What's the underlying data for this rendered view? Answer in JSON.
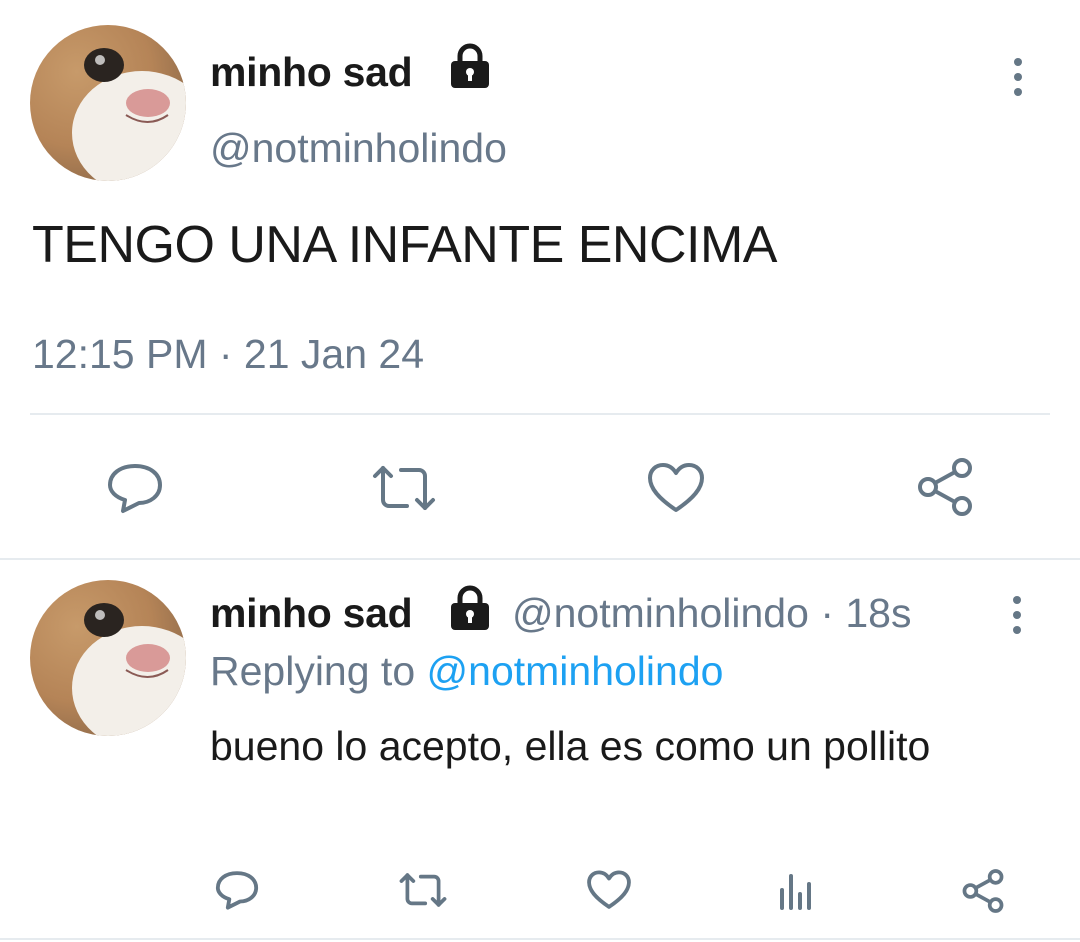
{
  "tweet": {
    "display_name": "minho sad",
    "handle": "@notminholindo",
    "text": "TENGO UNA INFANTE ENCIMA",
    "timestamp": "12:15 PM · 21 Jan 24",
    "actions": [
      "reply-icon",
      "retweet-icon",
      "like-icon",
      "share-icon"
    ]
  },
  "reply": {
    "display_name": "minho sad",
    "handle": "@notminholindo",
    "time": " · 18s",
    "replying_prefix": "Replying to ",
    "replying_handle": "@notminholindo",
    "text": "bueno lo acepto, ella es como un pollito",
    "actions": [
      "reply-icon",
      "retweet-icon",
      "like-icon",
      "analytics-icon",
      "share-icon"
    ]
  },
  "colors": {
    "text": "#1a1a1a",
    "muted": "#68788a",
    "icon": "#657786",
    "link": "#1da1f2",
    "divider": "#e6ebef"
  }
}
